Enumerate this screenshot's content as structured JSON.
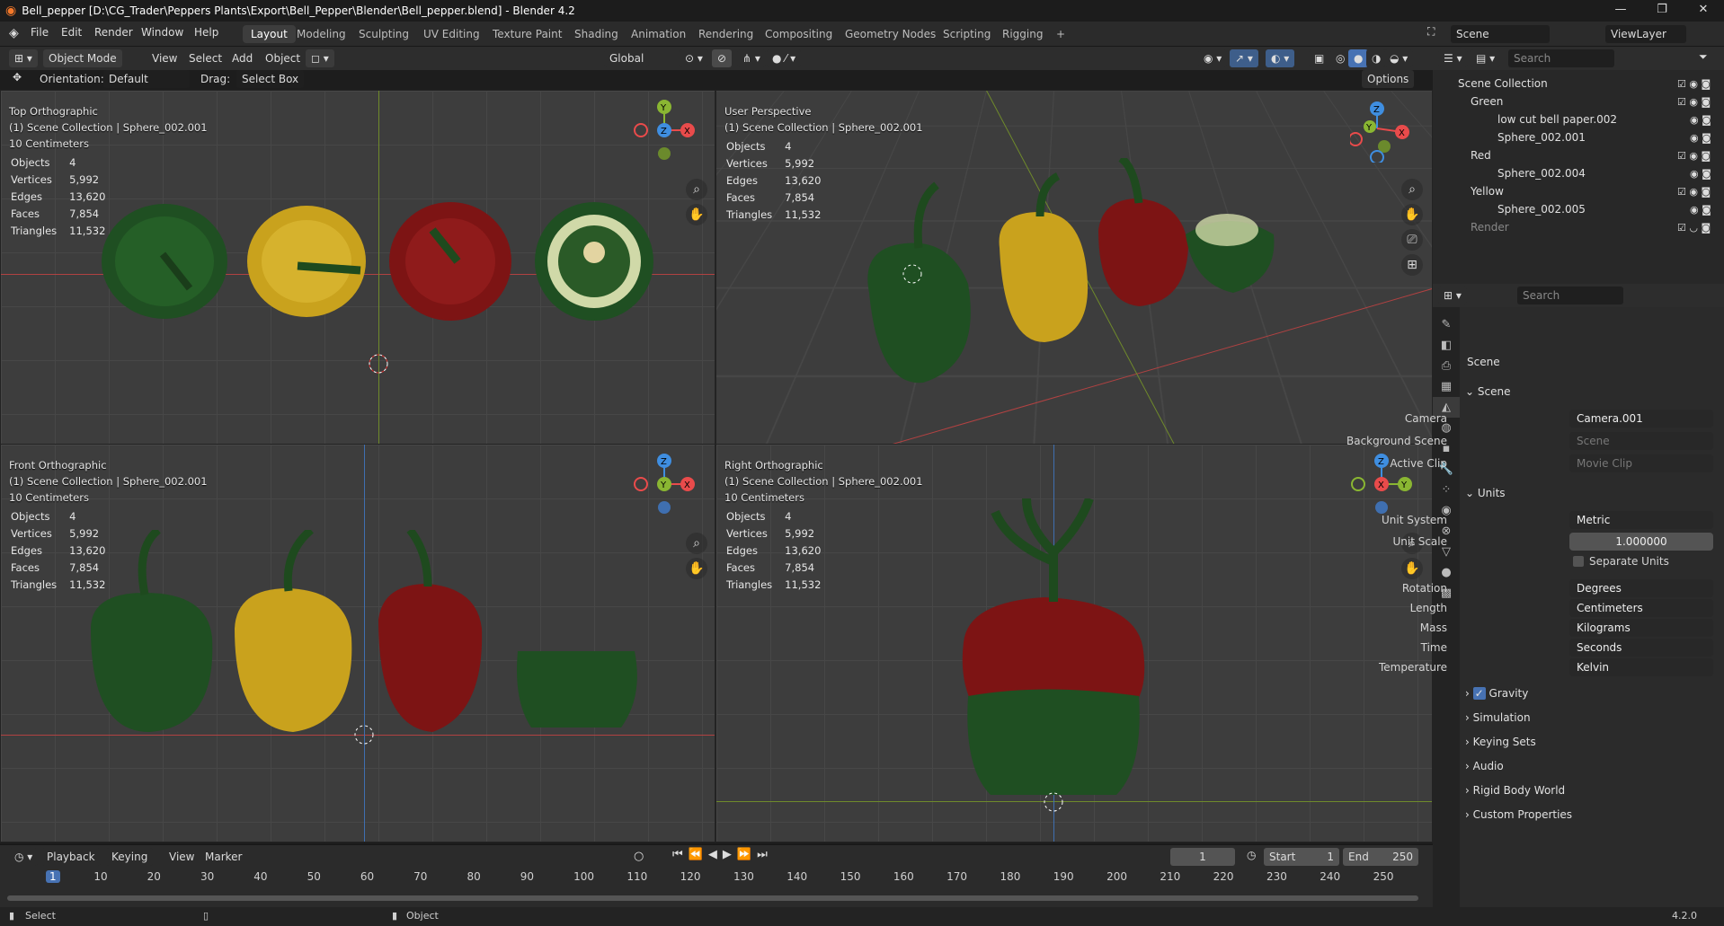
{
  "window": {
    "title": "Bell_pepper [D:\\CG_Trader\\Peppers Plants\\Export\\Bell_Pepper\\Blender\\Bell_pepper.blend] - Blender 4.2",
    "minimize": "—",
    "maximize": "❐",
    "close": "✕"
  },
  "menu": [
    "File",
    "Edit",
    "Render",
    "Window",
    "Help"
  ],
  "workspaces": [
    "Layout",
    "Modeling",
    "Sculpting",
    "UV Editing",
    "Texture Paint",
    "Shading",
    "Animation",
    "Rendering",
    "Compositing",
    "Geometry Nodes",
    "Scripting",
    "Rigging",
    "+"
  ],
  "active_workspace": "Layout",
  "scene_name": "Scene",
  "view_layer": "ViewLayer",
  "header": {
    "mode": "Object Mode",
    "view": "View",
    "select": "Select",
    "add": "Add",
    "object": "Object",
    "transform_orientation": "Global",
    "options": "Options",
    "orientation_label": "Orientation:",
    "orientation_value": "Default",
    "drag_label": "Drag:",
    "drag_value": "Select Box"
  },
  "viewports": [
    {
      "name": "Top Orthographic",
      "collection": "(1) Scene Collection | Sphere_002.001",
      "scale": "10 Centimeters"
    },
    {
      "name": "User Perspective",
      "collection": "(1) Scene Collection | Sphere_002.001",
      "scale": ""
    },
    {
      "name": "Front Orthographic",
      "collection": "(1) Scene Collection | Sphere_002.001",
      "scale": "10 Centimeters"
    },
    {
      "name": "Right Orthographic",
      "collection": "(1) Scene Collection | Sphere_002.001",
      "scale": "10 Centimeters"
    }
  ],
  "stats": {
    "objects_label": "Objects",
    "objects": "4",
    "vertices_label": "Vertices",
    "vertices": "5,992",
    "edges_label": "Edges",
    "edges": "13,620",
    "faces_label": "Faces",
    "faces": "7,854",
    "triangles_label": "Triangles",
    "triangles": "11,532"
  },
  "axes": {
    "x": "X",
    "y": "Y",
    "z": "Z"
  },
  "outliner": {
    "search_placeholder": "Search",
    "root": "Scene Collection",
    "items": [
      {
        "label": "Green",
        "type": "collection"
      },
      {
        "label": "low cut bell paper.002",
        "type": "object"
      },
      {
        "label": "Sphere_002.001",
        "type": "object"
      },
      {
        "label": "Red",
        "type": "collection"
      },
      {
        "label": "Sphere_002.004",
        "type": "object"
      },
      {
        "label": "Yellow",
        "type": "collection"
      },
      {
        "label": "Sphere_002.005",
        "type": "object"
      },
      {
        "label": "Render",
        "type": "collection"
      }
    ]
  },
  "properties": {
    "search_placeholder": "Search",
    "context": "Scene",
    "scene_panel": "Scene",
    "camera_label": "Camera",
    "camera": "Camera.001",
    "bg_scene_label": "Background Scene",
    "bg_scene_placeholder": "Scene",
    "active_clip_label": "Active Clip",
    "active_clip_placeholder": "Movie Clip",
    "units_panel": "Units",
    "unit_system_label": "Unit System",
    "unit_system": "Metric",
    "unit_scale_label": "Unit Scale",
    "unit_scale": "1.000000",
    "separate_units": "Separate Units",
    "rotation_label": "Rotation",
    "rotation": "Degrees",
    "length_label": "Length",
    "length": "Centimeters",
    "mass_label": "Mass",
    "mass": "Kilograms",
    "time_label": "Time",
    "time": "Seconds",
    "temperature_label": "Temperature",
    "temperature": "Kelvin",
    "gravity": "Gravity",
    "collapsed": [
      "Simulation",
      "Keying Sets",
      "Audio",
      "Rigid Body World",
      "Custom Properties"
    ]
  },
  "timeline": {
    "playback": "Playback",
    "keying": "Keying",
    "view": "View",
    "marker": "Marker",
    "current_frame": "1",
    "start_label": "Start",
    "start": "1",
    "end_label": "End",
    "end": "250",
    "ticks": [
      "1",
      "10",
      "20",
      "30",
      "40",
      "50",
      "60",
      "70",
      "80",
      "90",
      "100",
      "110",
      "120",
      "130",
      "140",
      "150",
      "160",
      "170",
      "180",
      "190",
      "200",
      "210",
      "220",
      "230",
      "240",
      "250"
    ]
  },
  "status": {
    "select": "Select",
    "object": "Object",
    "version": "4.2.0"
  },
  "colors": {
    "accent": "#4772b3",
    "x_axis": "#e94b4b",
    "y_axis": "#8ab632",
    "z_axis": "#3f8ee0",
    "green_pepper": "#1f4f22",
    "yellow_pepper": "#c9a21d",
    "red_pepper": "#7d1414"
  }
}
